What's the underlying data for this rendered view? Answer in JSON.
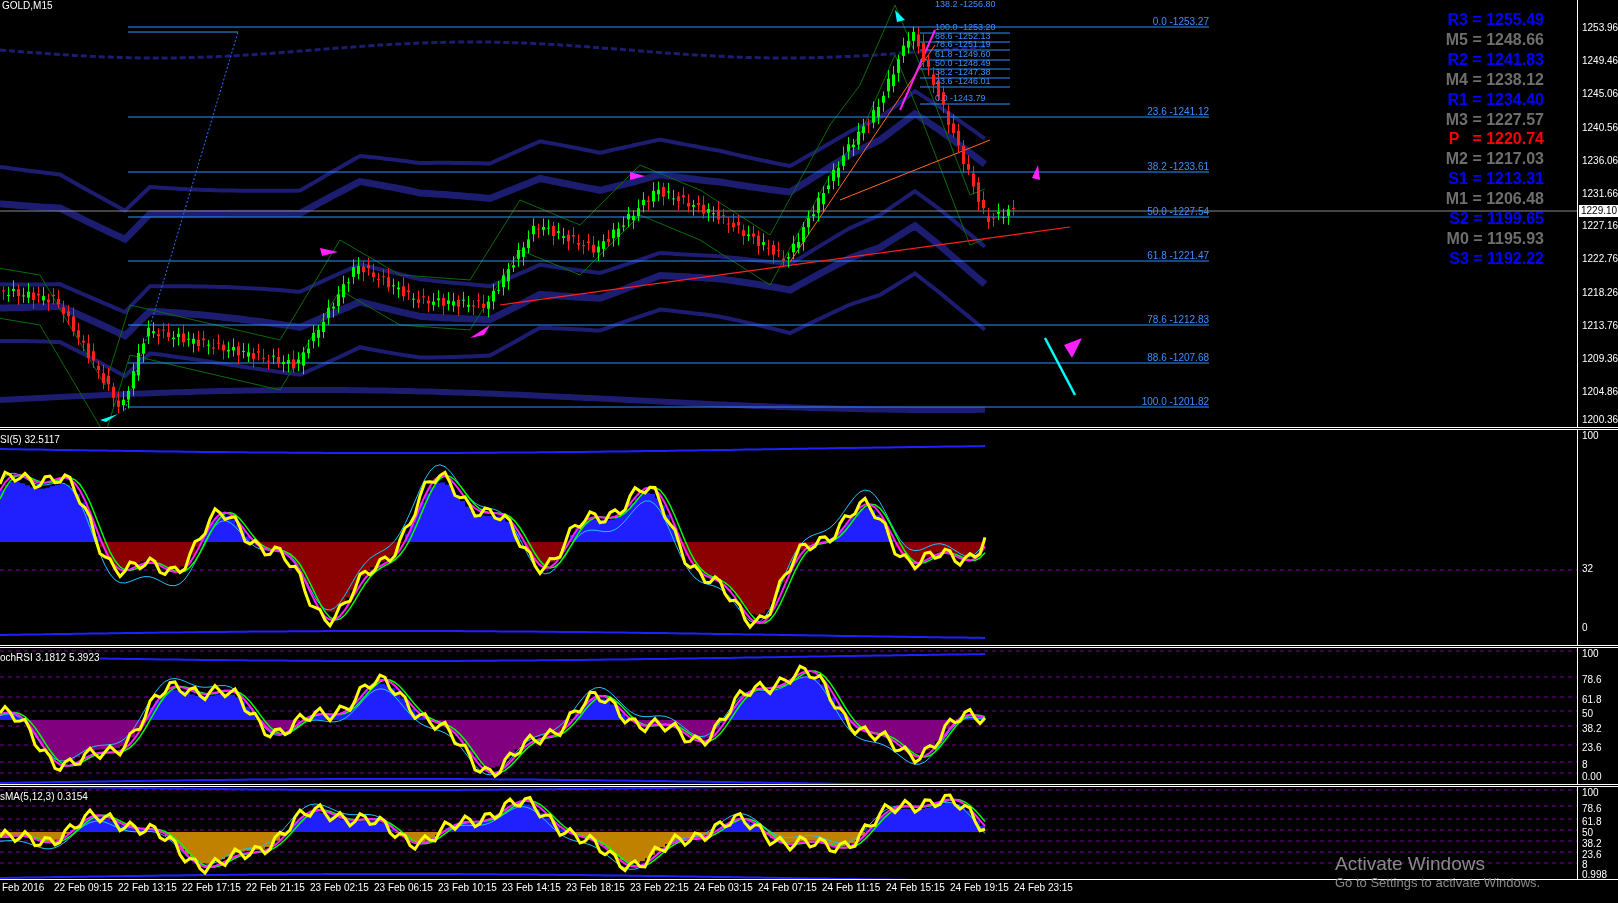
{
  "chart_title": "GOLD,M15",
  "pivot_levels": [
    {
      "label": "R3 = 1255.49",
      "color": "#0000ff"
    },
    {
      "label": "M5 = 1248.66",
      "color": "#6e6e6e"
    },
    {
      "label": "R2 = 1241.83",
      "color": "#0000ff"
    },
    {
      "label": "M4 = 1238.12",
      "color": "#6e6e6e"
    },
    {
      "label": "R1 = 1234.40",
      "color": "#0000ff"
    },
    {
      "label": "M3 = 1227.57",
      "color": "#6e6e6e"
    },
    {
      "label": "P   = 1220.74",
      "color": "#ff0000"
    },
    {
      "label": "M2 = 1217.03",
      "color": "#6e6e6e"
    },
    {
      "label": "S1 = 1213.31",
      "color": "#0000ff"
    },
    {
      "label": "M1 = 1206.48",
      "color": "#6e6e6e"
    },
    {
      "label": "S2 = 1199.65",
      "color": "#0000ff"
    },
    {
      "label": "M0 = 1195.93",
      "color": "#6e6e6e"
    },
    {
      "label": "S3 = 1192.22",
      "color": "#0000ff"
    }
  ],
  "fib_levels": [
    "0.0 -1253.27",
    "23.6 -1241.12",
    "38.2 -1233.61",
    "50.0 -1227.54",
    "61.8 -1221.47",
    "78.6 -1212.83",
    "88.6 -1207.68",
    "100.0 -1201.82"
  ],
  "fib_levels_small": [
    "138.2 -1256.80",
    "100.0 -1253.20",
    "88.6 -1252.13",
    "78.6 -1251.19",
    "61.8 -1249.60",
    "50.0 -1248.49",
    "38.2 -1247.38",
    "23.6 -1246.01",
    "0.0 -1243.79"
  ],
  "price_axis": {
    "ticks": [
      "1253.96",
      "1249.46",
      "1245.06",
      "1240.56",
      "1236.06",
      "1231.66",
      "1227.16",
      "1222.76",
      "1218.26",
      "1213.76",
      "1209.36",
      "1204.86",
      "1200.36"
    ],
    "current_price": "1229.10"
  },
  "rsi_panel": {
    "title": "SI(5) 32.5117",
    "ticks": [
      "100",
      "32",
      "0"
    ]
  },
  "stoch_rsi_panel": {
    "title": "ochRSI 3.1812 5.3923",
    "ticks": [
      "100",
      "78.6",
      "61.8",
      "50",
      "38.2",
      "23.6",
      "8",
      "0.00"
    ]
  },
  "osma_panel": {
    "title": "sMA(5,12,3) 0.3154",
    "ticks": [
      "100",
      "78.6",
      "61.8",
      "50",
      "38.2",
      "23.6",
      "8",
      "0.998"
    ]
  },
  "time_axis": [
    "Feb 2016",
    "22 Feb 09:15",
    "22 Feb 13:15",
    "22 Feb 17:15",
    "22 Feb 21:15",
    "23 Feb 02:15",
    "23 Feb 06:15",
    "23 Feb 10:15",
    "23 Feb 14:15",
    "23 Feb 18:15",
    "23 Feb 22:15",
    "24 Feb 03:15",
    "24 Feb 07:15",
    "24 Feb 11:15",
    "24 Feb 15:15",
    "24 Feb 19:15",
    "24 Feb 23:15"
  ],
  "os_notice": {
    "title": "Activate Windows",
    "subtitle": "Go to Settings to activate Windows."
  }
}
